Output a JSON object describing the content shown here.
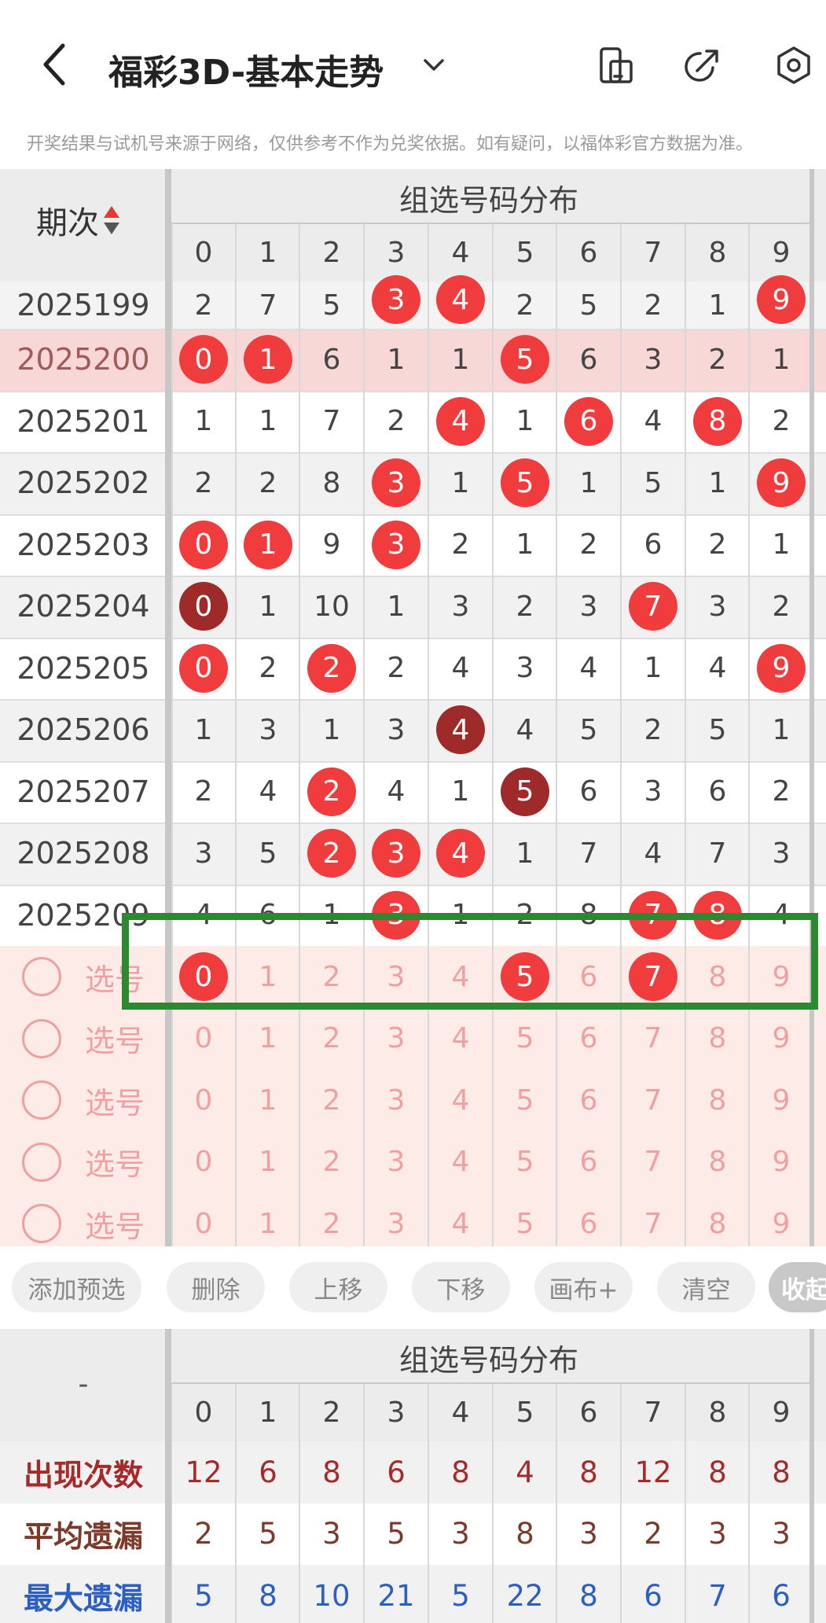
{
  "header": {
    "title": "福彩3D-基本走势",
    "notice": "开奖结果与试机号来源于网络，仅供参考不作为兑奖依据。如有疑问，以福体彩官方数据为准。"
  },
  "table": {
    "period_header": "期次",
    "group_header": "组选号码分布",
    "digits": [
      "0",
      "1",
      "2",
      "3",
      "4",
      "5",
      "6",
      "7",
      "8",
      "9"
    ],
    "rows": [
      {
        "period": "2025199",
        "cells": [
          "2",
          "7",
          "5",
          "3",
          "4",
          "2",
          "5",
          "2",
          "1",
          "9"
        ],
        "balls": [
          3,
          4,
          9
        ],
        "dark": []
      },
      {
        "period": "2025200",
        "cells": [
          "0",
          "1",
          "6",
          "1",
          "1",
          "5",
          "6",
          "3",
          "2",
          "1"
        ],
        "balls": [
          0,
          1,
          5
        ],
        "dark": [],
        "highlight": true
      },
      {
        "period": "2025201",
        "cells": [
          "1",
          "1",
          "7",
          "2",
          "4",
          "1",
          "6",
          "4",
          "8",
          "2"
        ],
        "balls": [
          4,
          6,
          8
        ],
        "dark": []
      },
      {
        "period": "2025202",
        "cells": [
          "2",
          "2",
          "8",
          "3",
          "1",
          "5",
          "1",
          "5",
          "1",
          "9"
        ],
        "balls": [
          3,
          5,
          9
        ],
        "dark": []
      },
      {
        "period": "2025203",
        "cells": [
          "0",
          "1",
          "9",
          "3",
          "2",
          "1",
          "2",
          "6",
          "2",
          "1"
        ],
        "balls": [
          0,
          1,
          3
        ],
        "dark": []
      },
      {
        "period": "2025204",
        "cells": [
          "0",
          "1",
          "10",
          "1",
          "3",
          "2",
          "3",
          "7",
          "3",
          "2"
        ],
        "balls": [
          0,
          7
        ],
        "dark": [
          0
        ]
      },
      {
        "period": "2025205",
        "cells": [
          "0",
          "2",
          "2",
          "2",
          "4",
          "3",
          "4",
          "1",
          "4",
          "9"
        ],
        "balls": [
          0,
          2,
          9
        ],
        "dark": []
      },
      {
        "period": "2025206",
        "cells": [
          "1",
          "3",
          "1",
          "3",
          "4",
          "4",
          "5",
          "2",
          "5",
          "1"
        ],
        "balls": [
          4
        ],
        "dark": [
          4
        ]
      },
      {
        "period": "2025207",
        "cells": [
          "2",
          "4",
          "2",
          "4",
          "1",
          "5",
          "6",
          "3",
          "6",
          "2"
        ],
        "balls": [
          2,
          5
        ],
        "dark": [
          5
        ]
      },
      {
        "period": "2025208",
        "cells": [
          "3",
          "5",
          "2",
          "3",
          "4",
          "1",
          "7",
          "4",
          "7",
          "3"
        ],
        "balls": [
          2,
          3,
          4
        ],
        "dark": []
      },
      {
        "period": "2025209",
        "cells": [
          "4",
          "6",
          "1",
          "3",
          "1",
          "2",
          "8",
          "7",
          "8",
          "4"
        ],
        "balls": [
          3,
          7,
          8
        ],
        "dark": []
      }
    ],
    "picker_label": "选号",
    "picker_rows": [
      {
        "selected": [
          0,
          5,
          7
        ]
      },
      {
        "selected": []
      },
      {
        "selected": []
      },
      {
        "selected": []
      },
      {
        "selected": []
      }
    ]
  },
  "buttons": [
    "添加预选",
    "删除",
    "上移",
    "下移",
    "画布+",
    "清空",
    "收起"
  ],
  "stats": {
    "corner": "-",
    "group_header": "组选号码分布",
    "rows": [
      {
        "label": "出现次数",
        "color": "#a52a2a",
        "values": [
          "12",
          "6",
          "8",
          "6",
          "8",
          "4",
          "8",
          "12",
          "8",
          "8"
        ]
      },
      {
        "label": "平均遗漏",
        "color": "#7b3b2b",
        "values": [
          "2",
          "5",
          "3",
          "5",
          "3",
          "8",
          "3",
          "2",
          "3",
          "3"
        ]
      },
      {
        "label": "最大遗漏",
        "color": "#2b5fc2",
        "values": [
          "5",
          "8",
          "10",
          "21",
          "5",
          "22",
          "8",
          "6",
          "7",
          "6"
        ]
      }
    ]
  },
  "colors": {
    "ball": "#f03c3c",
    "ball_dark": "#9e2a2a",
    "highlight_row": "#f8d7d7",
    "picker_bg": "#fdebe8",
    "picker_text": "#f0a0a0",
    "green_box": "#2b8a2f"
  }
}
